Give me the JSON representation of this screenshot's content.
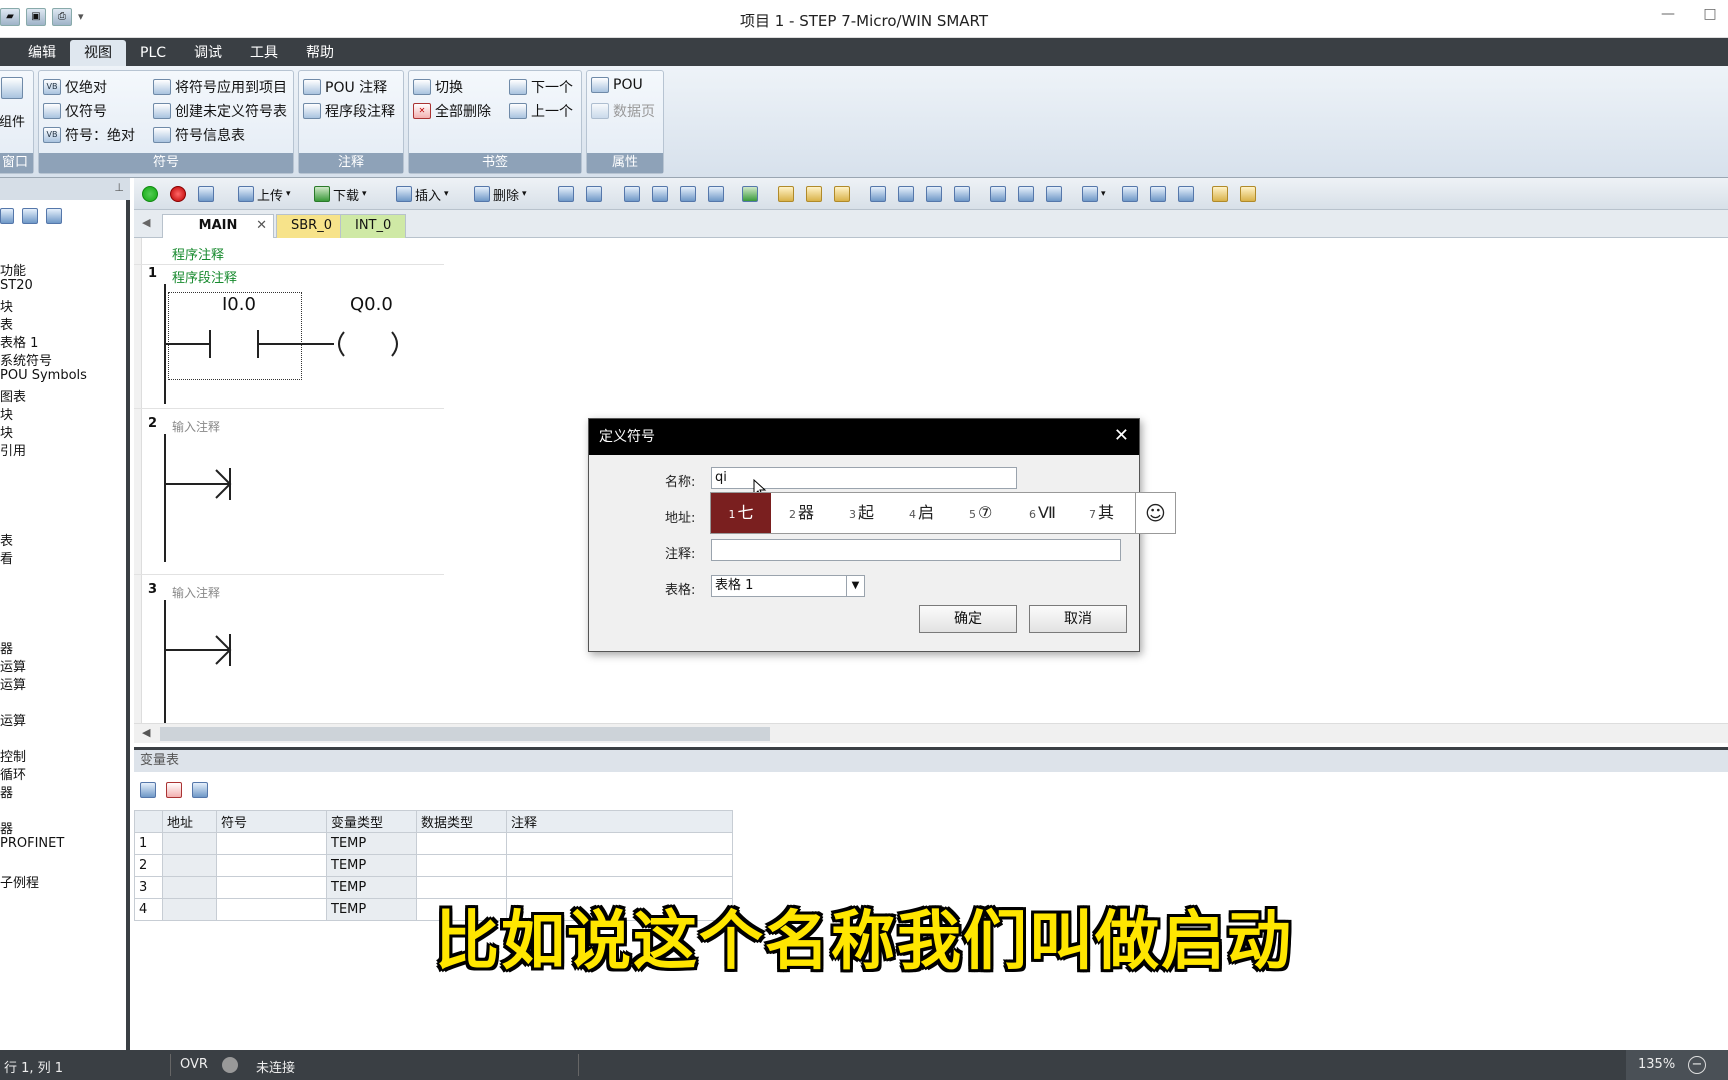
{
  "window": {
    "title": "项目 1 - STEP 7-Micro/WIN SMART"
  },
  "menu": [
    "编辑",
    "视图",
    "PLC",
    "调试",
    "工具",
    "帮助"
  ],
  "ribbon": {
    "left_stub": {
      "label": "组件",
      "group": "窗口"
    },
    "symbol": {
      "title": "符号",
      "items": [
        "仅绝对",
        "仅符号",
        "符号：绝对",
        "将符号应用到项目",
        "创建未定义符号表",
        "符号信息表"
      ]
    },
    "comment": {
      "title": "注释",
      "items": [
        "POU 注释",
        "程序段注释"
      ]
    },
    "bookmark": {
      "title": "书签",
      "items": [
        "切换",
        "全部删除",
        "下一个",
        "上一个"
      ]
    },
    "property": {
      "title": "属性",
      "items": [
        "POU",
        "数据页"
      ]
    }
  },
  "tree": [
    "功能",
    "ST20",
    "块",
    "表",
    "表格 1",
    "系统符号",
    "POU Symbols",
    "图表",
    "块",
    "块",
    "引用",
    "表",
    "看",
    "器",
    "运算",
    "运算",
    "运算",
    "控制",
    "循环",
    "器",
    "器",
    "PROFINET",
    "子例程"
  ],
  "toolbar": {
    "upload": "上传",
    "download": "下载",
    "insert": "插入",
    "delete": "删除"
  },
  "tabs": [
    "MAIN",
    "SBR_0",
    "INT_0"
  ],
  "ladder": {
    "program_comment": "程序注释",
    "rungs": [
      {
        "num": "1",
        "comment": "程序段注释",
        "contact": "I0.0",
        "coil": "Q0.0"
      },
      {
        "num": "2",
        "comment": "输入注释"
      },
      {
        "num": "3",
        "comment": "输入注释"
      }
    ]
  },
  "var_table": {
    "title": "变量表",
    "headers": [
      "地址",
      "符号",
      "变量类型",
      "数据类型",
      "注释"
    ],
    "rows": [
      {
        "n": "1",
        "type": "TEMP"
      },
      {
        "n": "2",
        "type": "TEMP"
      },
      {
        "n": "3",
        "type": "TEMP"
      },
      {
        "n": "4",
        "type": "TEMP"
      }
    ]
  },
  "dialog": {
    "title": "定义符号",
    "name_label": "名称:",
    "name_value": "qi",
    "address_label": "地址:",
    "comment_label": "注释:",
    "table_label": "表格:",
    "table_value": "表格 1",
    "ok": "确定",
    "cancel": "取消"
  },
  "ime": {
    "candidates": [
      {
        "n": "1",
        "c": "七"
      },
      {
        "n": "2",
        "c": "器"
      },
      {
        "n": "3",
        "c": "起"
      },
      {
        "n": "4",
        "c": "启"
      },
      {
        "n": "5",
        "c": "⑦"
      },
      {
        "n": "6",
        "c": "Ⅶ"
      },
      {
        "n": "7",
        "c": "其"
      }
    ],
    "emoji": "☺"
  },
  "status": {
    "position": "行 1, 列 1",
    "mode": "OVR",
    "connection": "未连接",
    "zoom": "135%"
  },
  "subtitle": "比如说这个名称我们叫做启动",
  "colors": {
    "dark": "#3a3f44",
    "ribbon_group_title": "#8ea2b8",
    "ime_selected": "#7a1f1f",
    "subtitle": "#ffe600"
  }
}
